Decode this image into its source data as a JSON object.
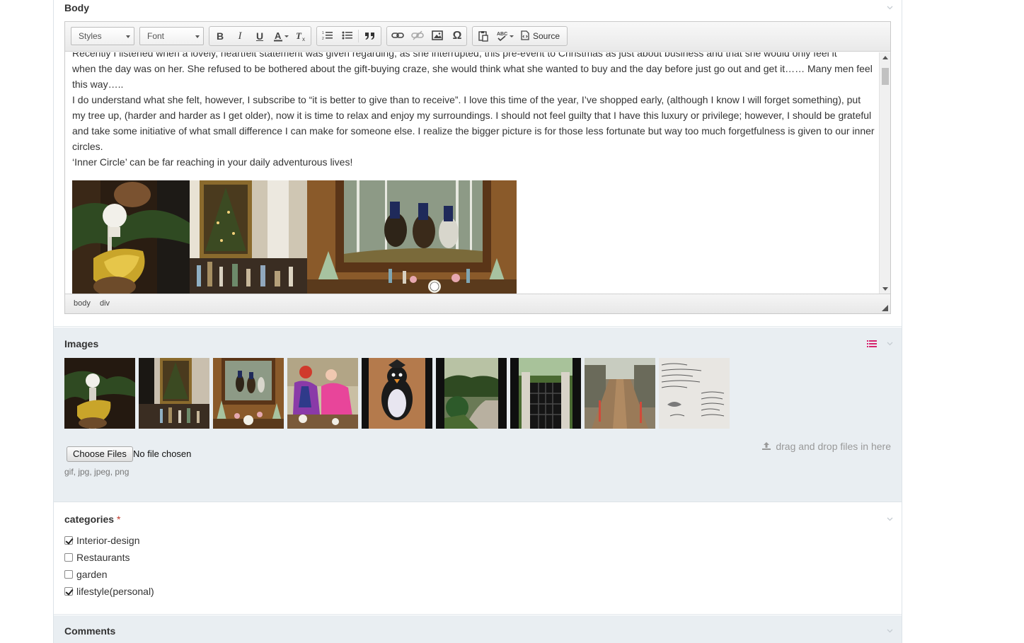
{
  "sections": {
    "body": {
      "title": "Body",
      "toolbar": {
        "styles_label": "Styles",
        "font_label": "Font",
        "source_label": "Source"
      },
      "content": {
        "paragraph_1a": "Recently I listened when a lovely, heartfelt statement was given regarding, as she interrupted, this pre-event to Christmas as just about business and that she would only feel it",
        "paragraph_1b": "when the day was on her. She refused to be bothered about the gift-buying craze, she would think what she wanted to buy and the day before just go out and get it…… Many men feel this way…..",
        "paragraph_2": "I do understand what she felt, however, I subscribe to “it is better to give than to receive”. I love this time of the year, I’ve shopped early, (although I know I will forget something), put my tree up, (harder and harder as I get older), now it is time to relax and enjoy my surroundings. I should not feel guilty that I have this luxury or privilege; however, I should be grateful and take some initiative of what small difference I can make for someone else. I realize the bigger picture is for those less fortunate but way too much forgetfulness is given to our inner circles.",
        "paragraph_3": "‘Inner Circle’ can be far reaching in your daily adventurous lives!"
      },
      "path": [
        "body",
        "div"
      ]
    },
    "images": {
      "title": "Images",
      "thumbnails": [
        "pinecone-newel-post",
        "christmas-tree-bar-cart",
        "fox-hunt-painting-mantel",
        "two-women-on-sofa",
        "penguin-ornament",
        "garden-path-boxwood",
        "iron-garden-gate",
        "garden-walkway",
        "handwritten-note"
      ],
      "choose_files_label": "Choose Files",
      "no_file_label": "No file chosen",
      "allowed_types": "gif, jpg, jpeg, png",
      "dnd_label": "drag and drop files in here"
    },
    "categories": {
      "title": "categories",
      "required_mark": "*",
      "items": [
        {
          "label": "Interior-design",
          "checked": true
        },
        {
          "label": "Restaurants",
          "checked": false
        },
        {
          "label": "garden",
          "checked": false
        },
        {
          "label": "lifestyle(personal)",
          "checked": true
        }
      ]
    },
    "comments": {
      "title": "Comments"
    }
  },
  "colors": {
    "section_alt_bg": "#e9eef2",
    "accent_pink": "#d6246e",
    "required": "#c0392b"
  }
}
